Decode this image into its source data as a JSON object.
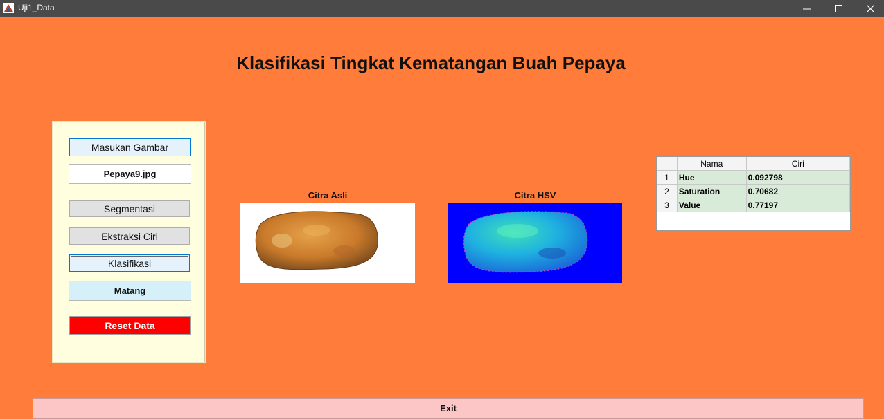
{
  "window": {
    "title": "Uji1_Data"
  },
  "main_title": "Klasifikasi Tingkat Kematangan Buah Pepaya",
  "panel": {
    "load_button": "Masukan Gambar",
    "filename": "Pepaya9.jpg",
    "segment_button": "Segmentasi",
    "extract_button": "Ekstraksi Ciri",
    "classify_button": "Klasifikasi",
    "result": "Matang",
    "reset_button": "Reset Data"
  },
  "images": {
    "original_title": "Citra Asli",
    "hsv_title": "Citra HSV"
  },
  "table": {
    "headers": [
      "Nama",
      "Ciri"
    ],
    "rows": [
      {
        "n": "1",
        "name": "Hue",
        "value": "0.092798"
      },
      {
        "n": "2",
        "name": "Saturation",
        "value": "0.70682"
      },
      {
        "n": "3",
        "name": "Value",
        "value": "0.77197"
      }
    ]
  },
  "exit_button": "Exit",
  "colors": {
    "background": "#ff7c3a",
    "panel": "#ffffe0",
    "reset": "#ff0000",
    "hsv_bg": "#0000ff",
    "exit": "#fcc6c6"
  }
}
